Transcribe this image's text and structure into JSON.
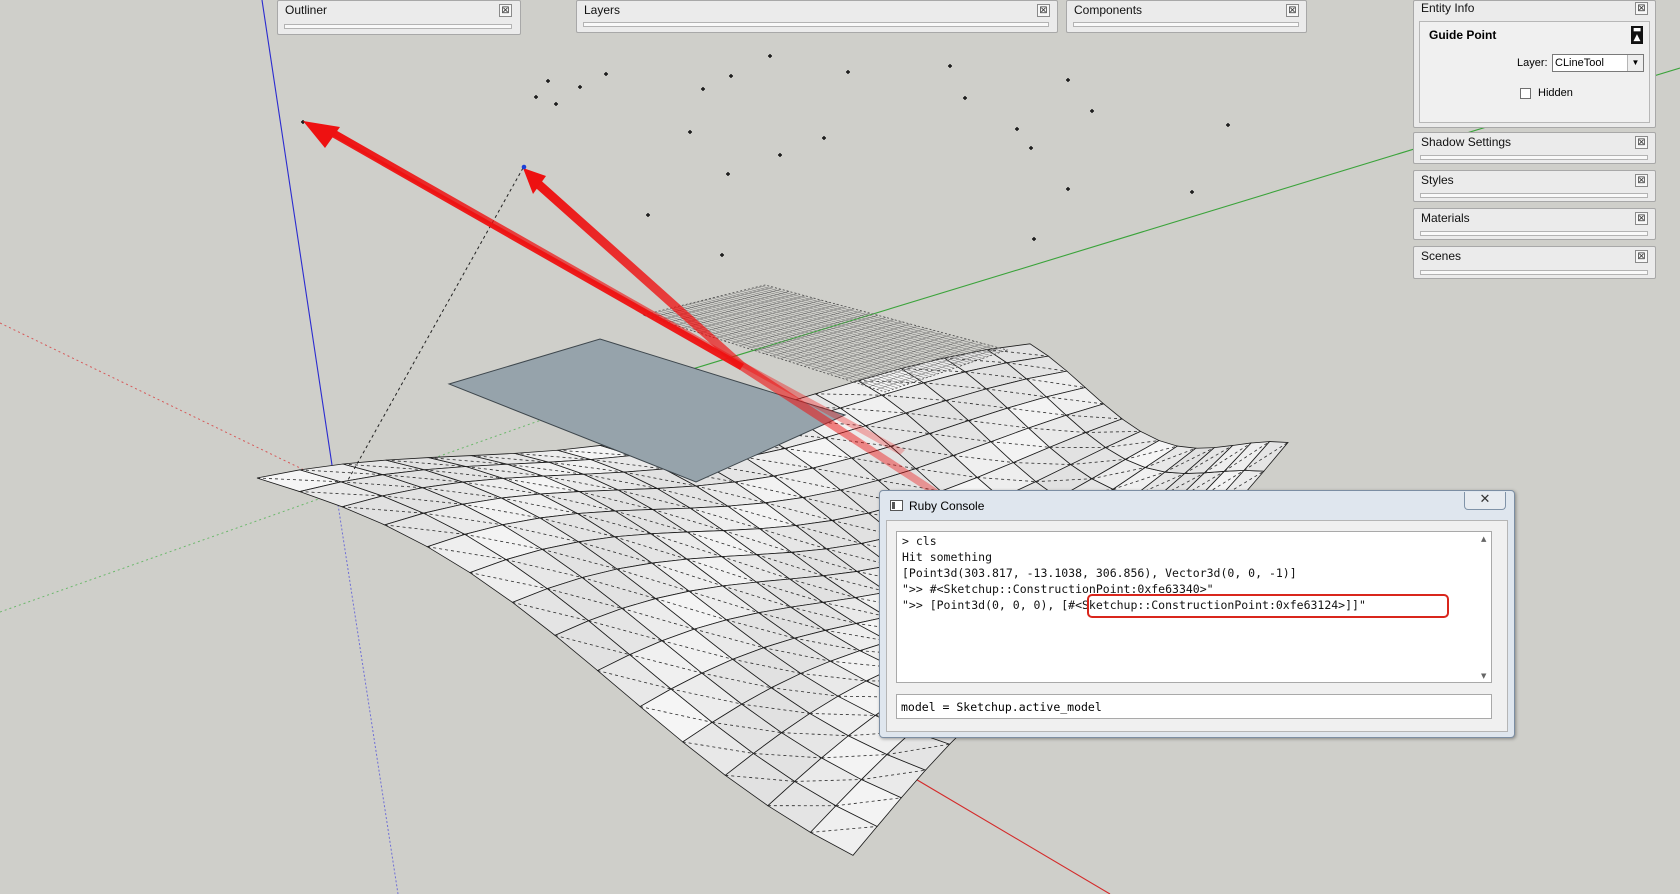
{
  "panels": {
    "outliner": {
      "title": "Outliner"
    },
    "layers": {
      "title": "Layers"
    },
    "components": {
      "title": "Components"
    },
    "entity_info": {
      "title": "Entity Info",
      "entity_type": "Guide Point",
      "layer_label": "Layer:",
      "layer_value": "CLineTool",
      "hidden_label": "Hidden",
      "hidden_checked": false
    },
    "shadow_settings": {
      "title": "Shadow Settings"
    },
    "styles": {
      "title": "Styles"
    },
    "materials": {
      "title": "Materials"
    },
    "scenes": {
      "title": "Scenes"
    },
    "close_glyph": "⊠"
  },
  "ruby_console": {
    "title": "Ruby Console",
    "close_glyph": "✕",
    "output_lines": [
      "> cls",
      "Hit something",
      "[Point3d(303.817, -13.1038, 306.856), Vector3d(0, 0, -1)]",
      "\">> #<Sketchup::ConstructionPoint:0xfe63340>\"",
      "\">> [Point3d(0, 0, 0), [#<Sketchup::ConstructionPoint:0xfe63124>]]\""
    ],
    "input_value": "model = Sketchup.active_model"
  },
  "colors": {
    "background": "#cfcfca",
    "x_axis": "#d42a2a",
    "y_axis": "#3aa33a",
    "z_axis": "#2b2bd0",
    "arrow": "#ee1111",
    "rectangle": "#96a3ab",
    "annotation": "#d9261c"
  }
}
